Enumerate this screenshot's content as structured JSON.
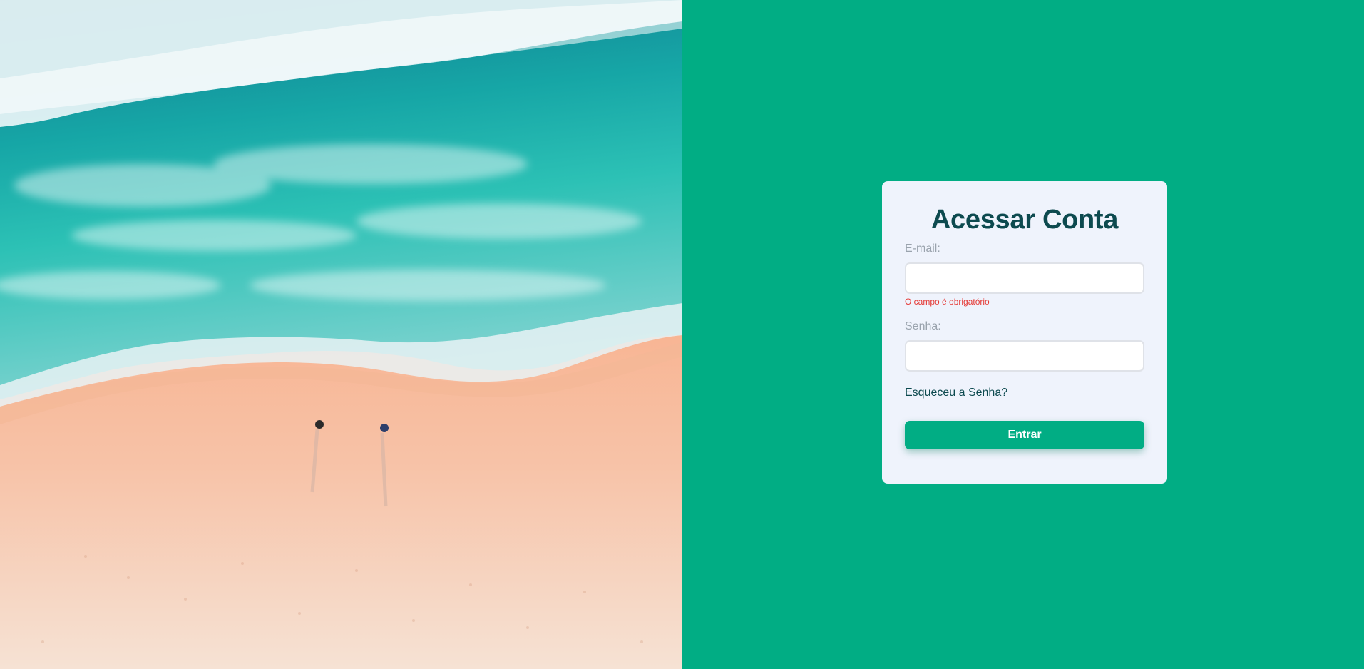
{
  "colors": {
    "background": "#01ad84",
    "card": "#eff3fc",
    "heading": "#0d4a4f",
    "label": "#9aa3ad",
    "error": "#e53935",
    "link": "#0d4a4f",
    "button": "#01ad84",
    "sea_deep": "#117f93",
    "sea_teal": "#18b5ae",
    "foam": "#e8f3f6",
    "sand": "#f9a77f",
    "sand_light": "#f8d8c6"
  },
  "hero": {
    "image_icon": "aerial-beach-photo"
  },
  "login": {
    "title": "Acessar Conta",
    "email_label": "E-mail:",
    "email_value": "",
    "email_error": "O campo é obrigatório",
    "password_label": "Senha:",
    "password_value": "",
    "forgot_link": "Esqueceu a Senha?",
    "submit_label": "Entrar"
  }
}
